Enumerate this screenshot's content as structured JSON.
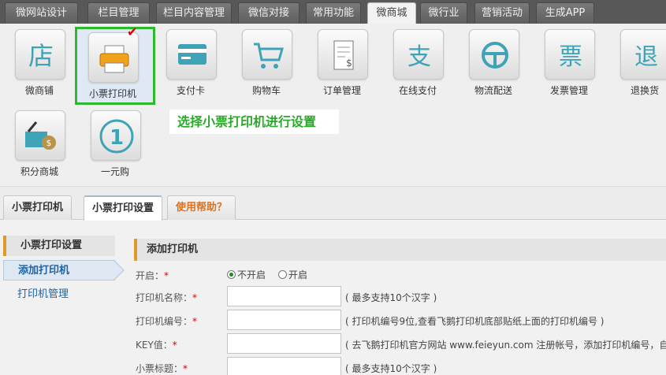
{
  "topnav": {
    "tabs": [
      {
        "label": "微网站设计",
        "active": false
      },
      {
        "label": "栏目管理",
        "active": false
      },
      {
        "label": "栏目内容管理",
        "active": false
      },
      {
        "label": "微信对接",
        "active": false
      },
      {
        "label": "常用功能",
        "active": false
      },
      {
        "label": "微商城",
        "active": true
      },
      {
        "label": "微行业",
        "active": false
      },
      {
        "label": "营销活动",
        "active": false
      },
      {
        "label": "生成APP",
        "active": false
      }
    ]
  },
  "icons": [
    {
      "label": "微商铺",
      "glyph": "店",
      "icon": "shop-icon"
    },
    {
      "label": "小票打印机",
      "glyph": "",
      "icon": "receipt-printer-icon",
      "selected": true
    },
    {
      "label": "支付卡",
      "glyph": "",
      "icon": "payment-card-icon"
    },
    {
      "label": "购物车",
      "glyph": "",
      "icon": "shopping-cart-icon"
    },
    {
      "label": "订单管理",
      "glyph": "",
      "icon": "order-document-icon"
    },
    {
      "label": "在线支付",
      "glyph": "支",
      "icon": "online-payment-icon"
    },
    {
      "label": "物流配送",
      "glyph": "",
      "icon": "steering-wheel-icon"
    },
    {
      "label": "发票管理",
      "glyph": "票",
      "icon": "invoice-icon"
    },
    {
      "label": "退换货",
      "glyph": "退",
      "icon": "return-icon"
    },
    {
      "label": "积分商城",
      "glyph": "",
      "icon": "points-basket-icon"
    },
    {
      "label": "一元购",
      "glyph": "",
      "icon": "one-yuan-icon"
    }
  ],
  "callout": "选择小票打印机进行设置",
  "subtabs": [
    {
      "label": "小票打印机",
      "active": false
    },
    {
      "label": "小票打印设置",
      "active": true
    },
    {
      "label": "使用帮助？",
      "active": false,
      "help": true
    }
  ],
  "sidebar": {
    "heading": "小票打印设置",
    "items": [
      {
        "label": "添加打印机",
        "active": true
      },
      {
        "label": "打印机管理",
        "active": false
      }
    ]
  },
  "form": {
    "heading": "添加打印机",
    "enable_label": "开启：",
    "enable_options": [
      {
        "label": "不开启",
        "checked": true
      },
      {
        "label": "开启",
        "checked": false
      }
    ],
    "fields": [
      {
        "label": "打印机名称：",
        "value": "",
        "hint": "( 最多支持10个汉字 )"
      },
      {
        "label": "打印机编号：",
        "value": "",
        "hint": "( 打印机编号9位,查看飞鹅打印机底部贴纸上面的打印机编号 )"
      },
      {
        "label": "KEY值：",
        "value": "",
        "hint": "( 去飞鹅打印机官方网站 www.feieyun.com 注册帐号，添加打印机编号，自动"
      },
      {
        "label": "小票标题：",
        "value": "",
        "hint": "( 最多支持10个汉字 )"
      }
    ],
    "required_mark": "*"
  }
}
